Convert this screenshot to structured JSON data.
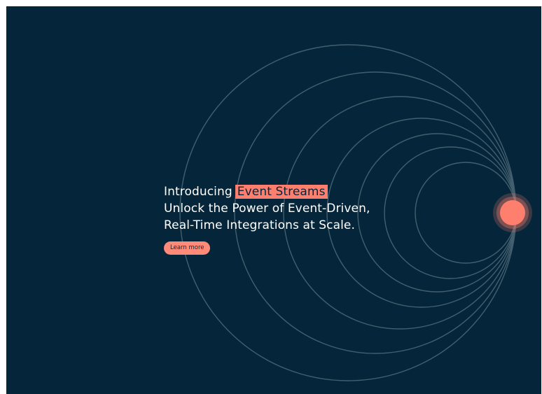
{
  "hero": {
    "intro": "Introducing",
    "highlight": "Event Streams",
    "line2": "Unlock the Power of Event-Driven,",
    "line3": "Real-Time Integrations at Scale."
  },
  "cta": {
    "label": "Learn more"
  },
  "colors": {
    "background": "#05263a",
    "accent": "#ff7f6e",
    "text": "#ffffff",
    "ring": "#4a6675"
  }
}
